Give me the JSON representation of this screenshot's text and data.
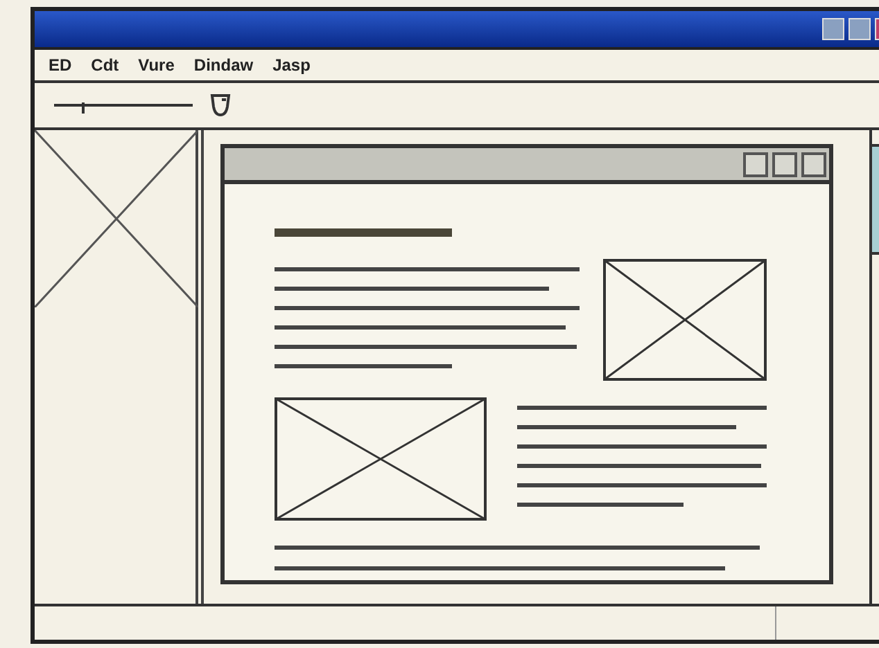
{
  "menu": [
    {
      "label": "ED"
    },
    {
      "label": "Cdt"
    },
    {
      "label": "Vure"
    },
    {
      "label": "Dindaw"
    },
    {
      "label": "Jasp"
    }
  ],
  "toolbar": {
    "slider": {
      "level": 0.2
    }
  }
}
